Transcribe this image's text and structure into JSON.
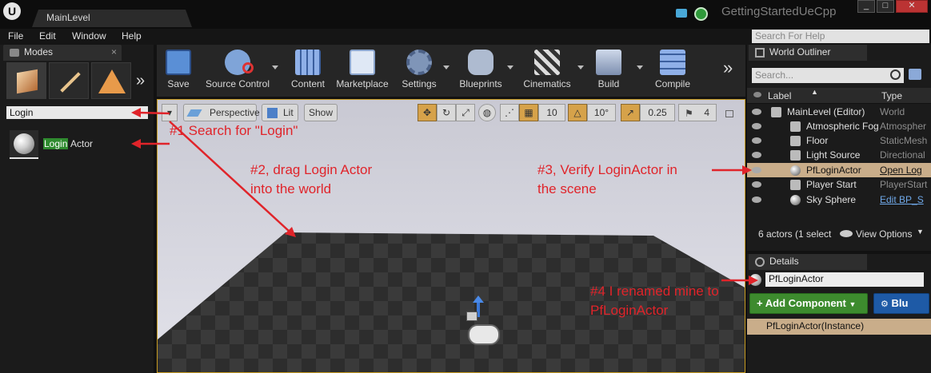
{
  "window": {
    "level_tab": "MainLevel",
    "project_name": "GettingStartedUeCpp",
    "buttons": [
      "_",
      "□",
      "✕"
    ]
  },
  "menu": {
    "items": [
      "File",
      "Edit",
      "Window",
      "Help"
    ],
    "help_search_placeholder": "Search For Help"
  },
  "modes": {
    "tab_label": "Modes",
    "search_value": "Login",
    "result_highlight": "Login",
    "result_rest": " Actor"
  },
  "toolbar": {
    "items": [
      "Save",
      "Source Control",
      "Content",
      "Marketplace",
      "Settings",
      "Blueprints",
      "Cinematics",
      "Build",
      "Compile"
    ],
    "more": "»"
  },
  "viewport": {
    "perspective": "Perspective",
    "lit": "Lit",
    "show": "Show",
    "grid_snap": "10",
    "rotation_snap": "10°",
    "scale_snap": "0.25",
    "camera_speed": "4"
  },
  "outliner": {
    "tab_label": "World Outliner",
    "search_placeholder": "Search...",
    "col_label": "Label",
    "col_type": "Type",
    "rows": [
      {
        "name": "MainLevel (Editor)",
        "type": "World"
      },
      {
        "name": "Atmospheric Fog",
        "type": "Atmospher"
      },
      {
        "name": "Floor",
        "type": "StaticMesh"
      },
      {
        "name": "Light Source",
        "type": "Directional"
      },
      {
        "name": "PfLoginActor",
        "type": "Open Log"
      },
      {
        "name": "Player Start",
        "type": "PlayerStart"
      },
      {
        "name": "Sky Sphere",
        "type": "Edit BP_S"
      }
    ],
    "footer": "6 actors (1 select",
    "view_options": "View Options"
  },
  "details": {
    "tab_label": "Details",
    "name_value": "PfLoginActor",
    "add_component": "Add Component",
    "blueprint_btn": "Blu",
    "instance_row": "PfLoginActor(Instance)"
  },
  "annotations": {
    "step1": "#1 Search for \"Login\"",
    "step2": "#2, drag Login Actor\ninto the world",
    "step3": "#3, Verify LoginActor in\nthe scene",
    "step4": "#4 I renamed mine to\nPfLoginActor"
  },
  "colors": {
    "annotation": "#e0242a",
    "selected_row": "#c9ad8a",
    "add_component": "#3d8b2e",
    "blueprint": "#1e5aa6"
  }
}
